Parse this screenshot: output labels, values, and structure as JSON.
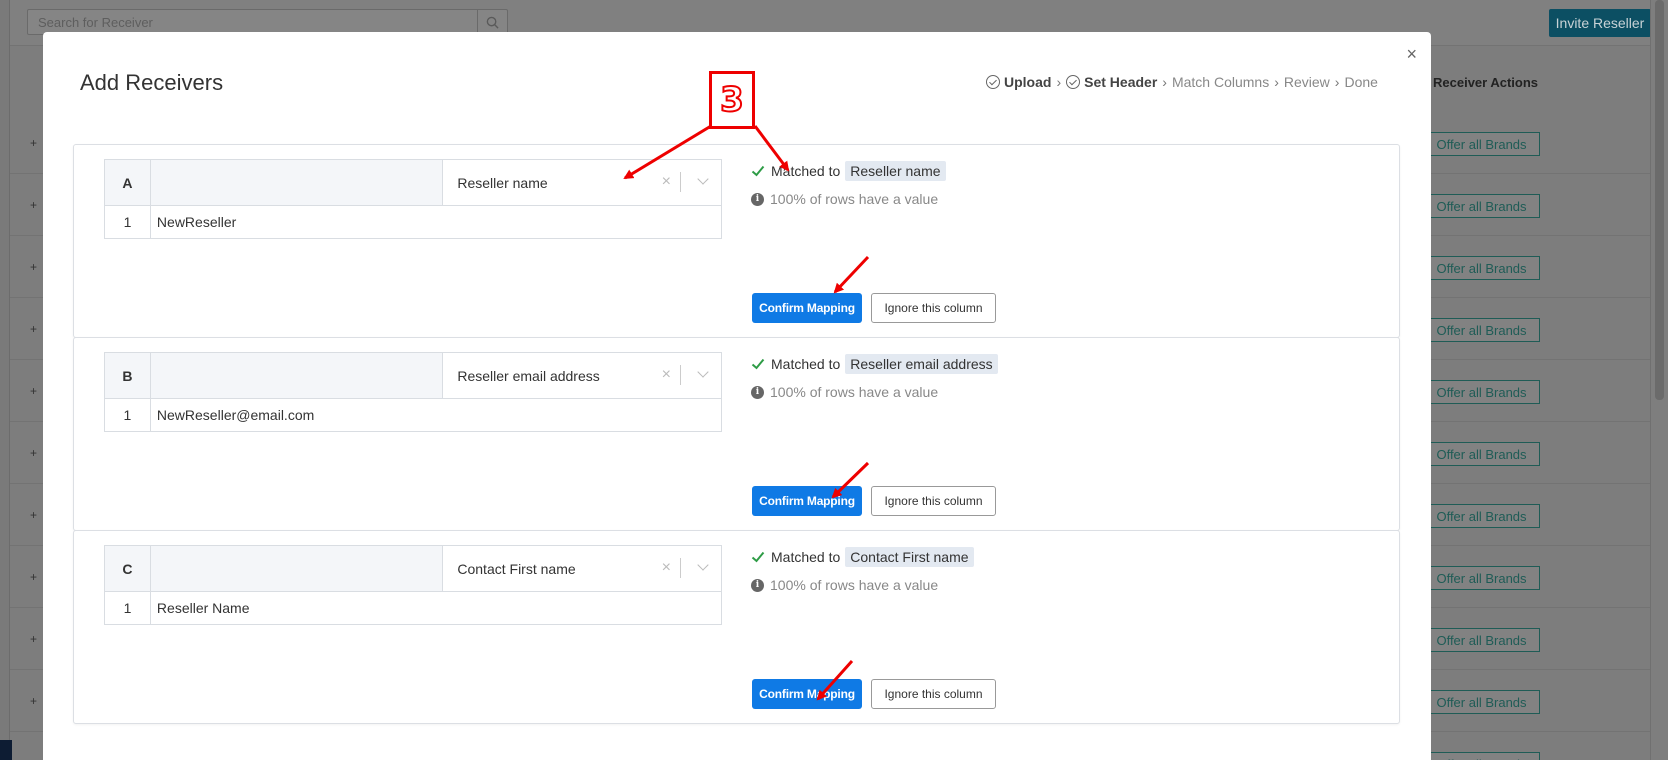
{
  "background": {
    "search_placeholder": "Search for Receiver",
    "invite_button": "Invite Reseller",
    "column_header": "Receiver Actions",
    "row_expand": "+",
    "offer_button": "Offer all Brands",
    "rows": 11
  },
  "modal": {
    "title": "Add Receivers",
    "close": "×",
    "steps": [
      {
        "label": "Upload",
        "done": true
      },
      {
        "label": "Set Header",
        "done": true
      },
      {
        "label": "Match Columns",
        "done": false
      },
      {
        "label": "Review",
        "done": false
      },
      {
        "label": "Done",
        "done": false
      }
    ],
    "step_separator": "›",
    "matched_prefix": "Matched to",
    "confirm_label": "Confirm Mapping",
    "ignore_label": "Ignore this column",
    "clear_symbol": "×",
    "columns": [
      {
        "letter": "A",
        "header": "Reseller name",
        "row_num": "1",
        "value": "NewReseller",
        "matched_to": "Reseller name",
        "pct_text": "100% of rows have a value"
      },
      {
        "letter": "B",
        "header": "Reseller email address",
        "row_num": "1",
        "value": "NewReseller@email.com",
        "matched_to": "Reseller email address",
        "pct_text": "100% of rows have a value"
      },
      {
        "letter": "C",
        "header": "Contact First name",
        "row_num": "1",
        "value": "Reseller Name",
        "matched_to": "Contact First name",
        "pct_text": "100% of rows have a value"
      }
    ]
  },
  "annotation": {
    "step_number": "3",
    "color": "#e00000"
  },
  "colors": {
    "primary": "#0f7ae5",
    "success": "#2e9c46",
    "invite": "#0c4f63",
    "offer": "#1f5c56"
  }
}
